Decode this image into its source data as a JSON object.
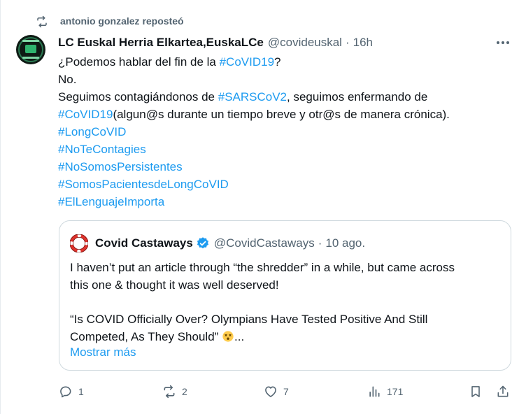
{
  "repost": {
    "text": "antonio gonzalez reposteó",
    "icon": "repost-icon"
  },
  "tweet": {
    "author_name": "LC Euskal Herria Elkartea,EuskaLCe",
    "author_handle": "@covideuskal",
    "separator": "·",
    "time": "16h",
    "lines": [
      [
        {
          "t": "¿Podemos hablar del fin de la "
        },
        {
          "t": "#CoVID19",
          "tag": true
        },
        {
          "t": "?"
        }
      ],
      [
        {
          "t": "No."
        }
      ],
      [
        {
          "t": "Seguimos contagiándonos de "
        },
        {
          "t": "#SARSCoV2",
          "tag": true
        },
        {
          "t": ", seguimos enfermando de"
        }
      ],
      [
        {
          "t": "#CoVID19",
          "tag": true
        },
        {
          "t": "(algun@s durante un tiempo breve y otr@s de manera crónica)."
        }
      ],
      [
        {
          "t": "#LongCoVID",
          "tag": true
        }
      ],
      [
        {
          "t": "#NoTeContagies",
          "tag": true
        }
      ],
      [
        {
          "t": "#NoSomosPersistentes",
          "tag": true
        }
      ],
      [
        {
          "t": "#SomosPacientesdeLongCoVID",
          "tag": true
        }
      ],
      [
        {
          "t": "#ElLenguajeImporta",
          "tag": true
        }
      ]
    ]
  },
  "quote": {
    "author_name": "Covid Castaways",
    "author_handle": "@CovidCastaways",
    "separator": "·",
    "time": "10 ago.",
    "lines": [
      "I haven’t put an article through “the shredder” in a while, but came across",
      "this one & thought it was well deserved!",
      "",
      "“Is COVID Officially Over? Olympians Have Tested Positive And Still",
      "Competed, As They Should”"
    ],
    "ellipsis": "...",
    "emoji": "dizzy-face-emoji",
    "show_more": "Mostrar más"
  },
  "actions": {
    "reply_count": "1",
    "repost_count": "2",
    "like_count": "7",
    "views_count": "171"
  },
  "colors": {
    "accent": "#1d9bf0",
    "text": "#0f1419",
    "secondary": "#536471",
    "border": "#cfd9de"
  }
}
